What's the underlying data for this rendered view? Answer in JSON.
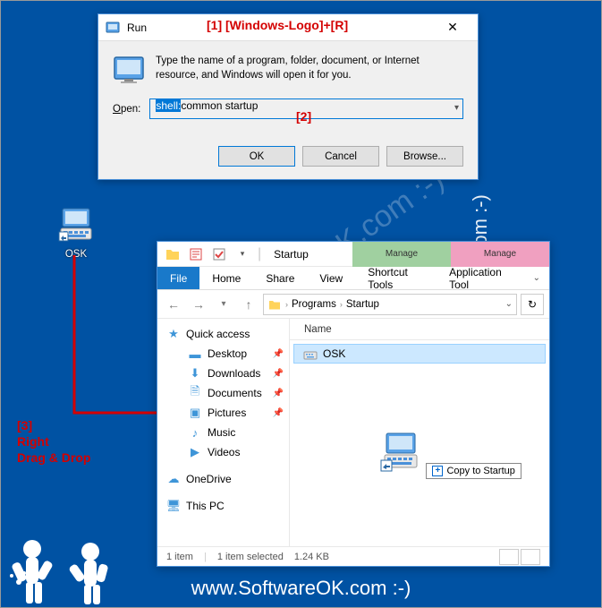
{
  "watermark": "www.SoftwareOK.com :-)",
  "annotations": {
    "one": "[1]   [Windows-Logo]+[R]",
    "two": "[2]",
    "three_a": "[3]",
    "three_b": "Right",
    "three_c": "Drag & Drop"
  },
  "run": {
    "title": "Run",
    "description": "Type the name of a program, folder, document, or Internet resource, and Windows will open it for you.",
    "open_label_pre": "O",
    "open_label_post": "pen:",
    "input_selected": "shell:",
    "input_rest": "common startup",
    "ok": "OK",
    "cancel": "Cancel",
    "browse": "Browse..."
  },
  "desktop_icon": {
    "label": "OSK"
  },
  "explorer": {
    "title": "Startup",
    "ctx_tab1": "Manage",
    "ctx_tab2": "Manage",
    "ribbon": {
      "file": "File",
      "home": "Home",
      "share": "Share",
      "view": "View",
      "ctx1": "Shortcut Tools",
      "ctx2": "Application Tool"
    },
    "breadcrumb": {
      "a": "Programs",
      "b": "Startup"
    },
    "col_name": "Name",
    "item": "OSK",
    "drop_label": "Copy to Startup",
    "sidebar": {
      "quick": "Quick access",
      "desktop": "Desktop",
      "downloads": "Downloads",
      "documents": "Documents",
      "pictures": "Pictures",
      "music": "Music",
      "videos": "Videos",
      "onedrive": "OneDrive",
      "thispc": "This PC"
    },
    "status": {
      "count": "1 item",
      "sel": "1 item selected",
      "size": "1.24 KB"
    }
  }
}
